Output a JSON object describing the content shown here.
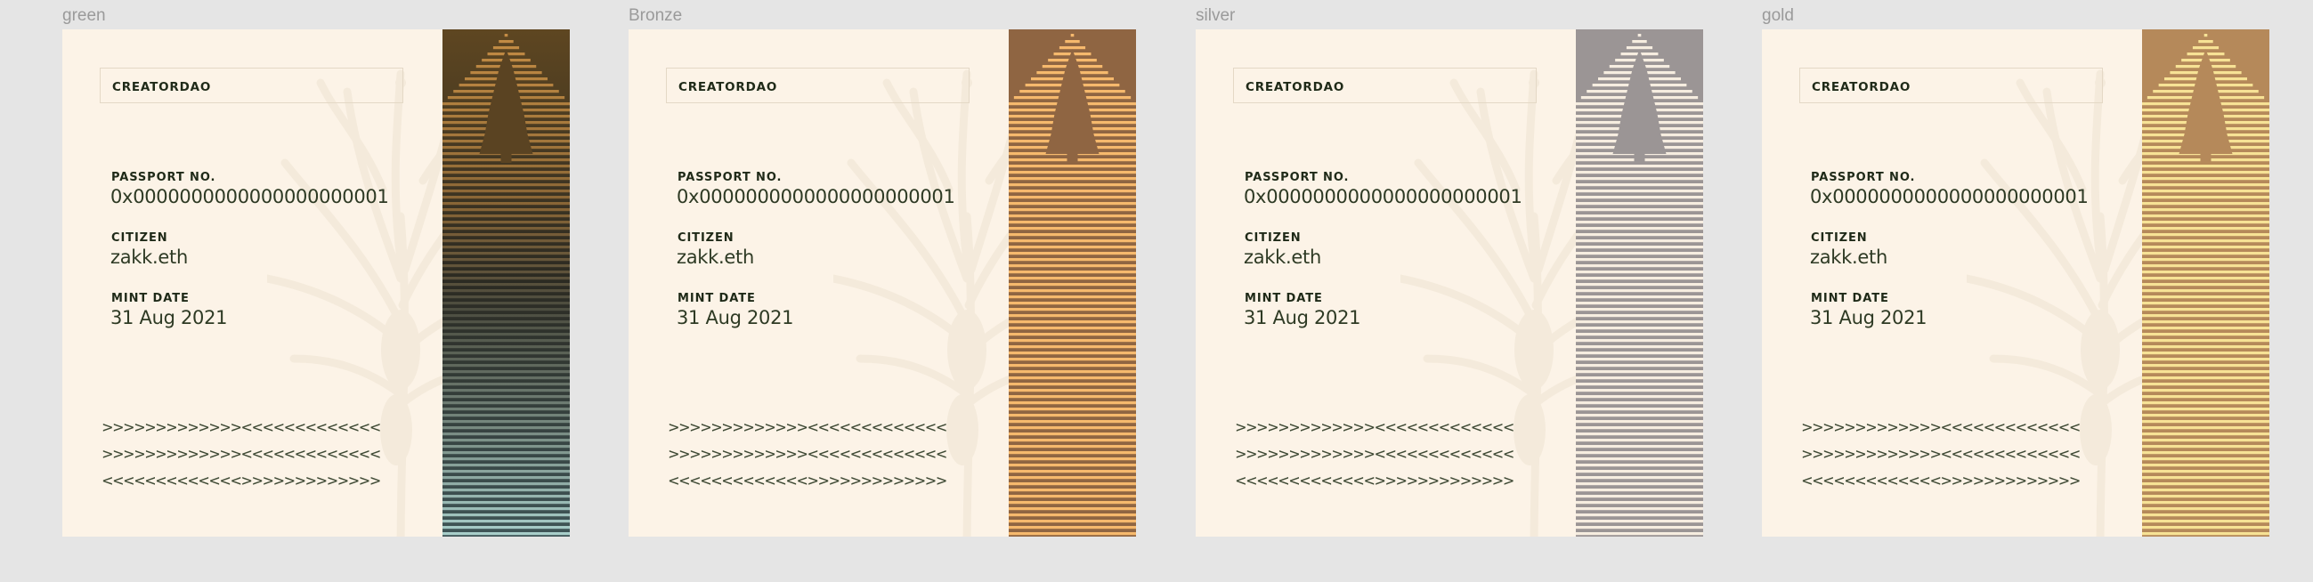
{
  "cards": [
    {
      "variant": "green",
      "org": "CREATORDAO",
      "passport_label": "PASSPORT NO.",
      "passport_no": "0x0000000000000000000001",
      "citizen_label": "CITIZEN",
      "citizen": "zakk.eth",
      "mint_label": "MINT DATE",
      "mint_date": "31 Aug 2021",
      "mrz": [
        ">>>>>>>>>>>>><<<<<<<<<<<<<",
        ">>>>>>>>>>>>><<<<<<<<<<<<<",
        "<<<<<<<<<<<<<>>>>>>>>>>>>>"
      ],
      "colors": {
        "panel_top": "#5e4621",
        "panel_mid": "#2b2a22",
        "panel_bottom": "#3f5557",
        "stripe_top": "#c58d45",
        "stripe_bottom": "#a9d0cc",
        "tree": "#5a4322"
      }
    },
    {
      "variant": "Bronze",
      "org": "CREATORDAO",
      "passport_label": "PASSPORT NO.",
      "passport_no": "0x0000000000000000000001",
      "citizen_label": "CITIZEN",
      "citizen": "zakk.eth",
      "mint_label": "MINT DATE",
      "mint_date": "31 Aug 2021",
      "mrz": [
        ">>>>>>>>>>>>><<<<<<<<<<<<<",
        ">>>>>>>>>>>>><<<<<<<<<<<<<",
        "<<<<<<<<<<<<<>>>>>>>>>>>>>"
      ],
      "colors": {
        "panel_top": "#8f6542",
        "panel_mid": "#8f6542",
        "panel_bottom": "#8f6542",
        "stripe_top": "#f6b96d",
        "stripe_bottom": "#f6b96d",
        "tree": "#8f6542"
      }
    },
    {
      "variant": "silver",
      "org": "CREATORDAO",
      "passport_label": "PASSPORT NO.",
      "passport_no": "0x0000000000000000000001",
      "citizen_label": "CITIZEN",
      "citizen": "zakk.eth",
      "mint_label": "MINT DATE",
      "mint_date": "31 Aug 2021",
      "mrz": [
        ">>>>>>>>>>>>><<<<<<<<<<<<<",
        ">>>>>>>>>>>>><<<<<<<<<<<<<",
        "<<<<<<<<<<<<<>>>>>>>>>>>>>"
      ],
      "colors": {
        "panel_top": "#9b9595",
        "panel_mid": "#9b9595",
        "panel_bottom": "#9b9595",
        "stripe_top": "#f6ede0",
        "stripe_bottom": "#f6ede0",
        "tree": "#9b9595"
      }
    },
    {
      "variant": "gold",
      "org": "CREATORDAO",
      "passport_label": "PASSPORT NO.",
      "passport_no": "0x0000000000000000000001",
      "citizen_label": "CITIZEN",
      "citizen": "zakk.eth",
      "mint_label": "MINT DATE",
      "mint_date": "31 Aug 2021",
      "mrz": [
        ">>>>>>>>>>>>><<<<<<<<<<<<<",
        ">>>>>>>>>>>>><<<<<<<<<<<<<",
        "<<<<<<<<<<<<<>>>>>>>>>>>>>"
      ],
      "colors": {
        "panel_top": "#b5895a",
        "panel_mid": "#b5895a",
        "panel_bottom": "#b5895a",
        "stripe_top": "#f7e295",
        "stripe_bottom": "#f7e295",
        "tree": "#b5895a"
      }
    }
  ]
}
